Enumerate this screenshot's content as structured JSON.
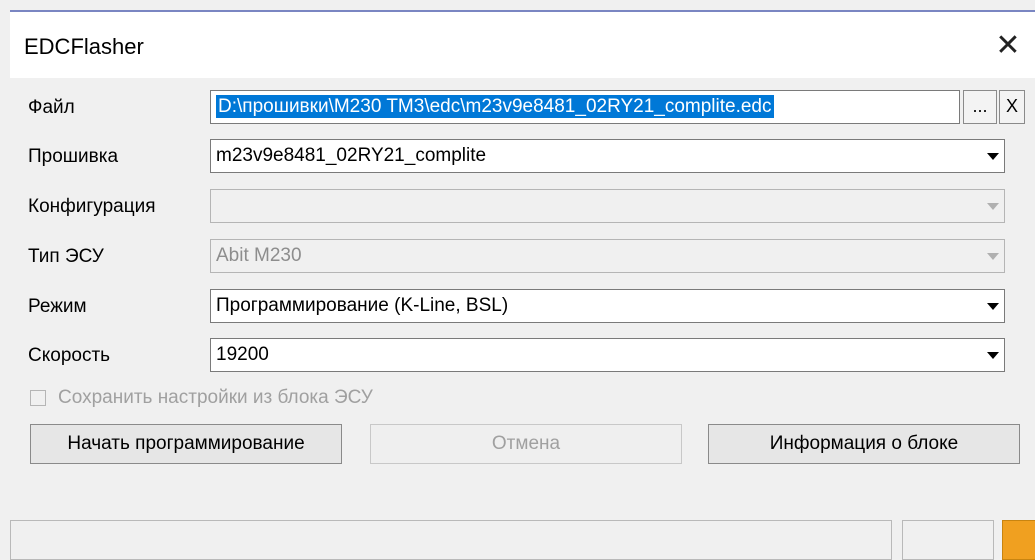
{
  "window": {
    "title": "EDCFlasher",
    "close_glyph": "✕"
  },
  "fields": {
    "file": {
      "label": "Файл",
      "value": "D:\\прошивки\\M230 TM3\\edc\\m23v9e8481_02RY21_complite.edc",
      "browse_label": "...",
      "clear_label": "X"
    },
    "firmware": {
      "label": "Прошивка",
      "value": "m23v9e8481_02RY21_complite"
    },
    "configuration": {
      "label": "Конфигурация",
      "value": ""
    },
    "ecu_type": {
      "label": "Тип ЭСУ",
      "value": "Abit M230"
    },
    "mode": {
      "label": "Режим",
      "value": "Программирование (K-Line, BSL)"
    },
    "speed": {
      "label": "Скорость",
      "value": "19200"
    }
  },
  "save_settings": {
    "label": "Сохранить настройки из блока ЭСУ",
    "checked": false
  },
  "buttons": {
    "start": "Начать программирование",
    "cancel": "Отмена",
    "info": "Информация о блоке"
  },
  "colors": {
    "selection": "#0078d7",
    "status_indicator": "#f0a020",
    "title_accent": "#7a86c2"
  },
  "icons": {
    "close": "close-icon",
    "dropdown": "chevron-down-icon"
  }
}
